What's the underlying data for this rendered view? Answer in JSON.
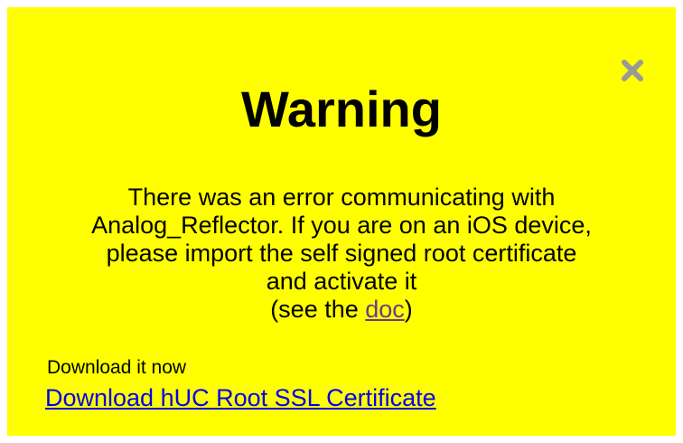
{
  "dialog": {
    "title": "Warning",
    "close_icon": "close-icon",
    "message_lines": [
      "There was an error communicating with",
      "Analog_Reflector. If you are on an iOS device,",
      "please import the self signed root certificate",
      "and activate it"
    ],
    "see_prefix": "(see the ",
    "doc_link_label": "doc",
    "see_suffix": ")",
    "download_label": "Download it now",
    "download_link_label": "Download hUC Root SSL Certificate"
  },
  "colors": {
    "background": "#ffff00",
    "close_icon": "#999999",
    "link": "#0000ee",
    "visited_link": "#6b3a8c"
  }
}
